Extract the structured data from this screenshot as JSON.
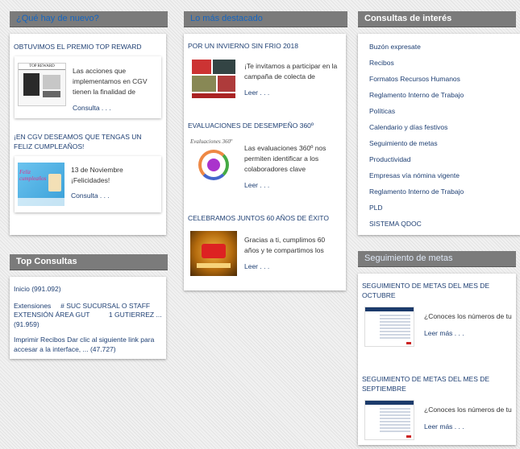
{
  "col1": {
    "header": "¿Qué hay de nuevo?",
    "articles": [
      {
        "title": "OBTUVIMOS EL PREMIO TOP REWARD",
        "text": "Las acciones que implementamos en CGV tienen la finalidad de",
        "more": "Consulta . . .",
        "thumb_text": "TOP REWARD"
      },
      {
        "title": "¡EN CGV DESEAMOS QUE TENGAS UN FELIZ CUMPLEAÑOS!",
        "text_line1": "13 de Noviembre",
        "text_line2": "¡Felicidades!",
        "more": "Consulta . . .",
        "thumb_text": "Feliz cumpleaños"
      }
    ]
  },
  "top_consultas": {
    "header": "Top Consultas",
    "items": [
      "Inicio (991.092)",
      "Extensiones     # SUC SUCURSAL O STAFF EXTENSIÓN ÁREA GUT          1 GUTIERREZ ... (91.959)",
      "Imprimir Recibos Dar clic al siguiente link para accesar a la interface, ... (47.727)"
    ]
  },
  "col2": {
    "header": "Lo más destacado",
    "articles": [
      {
        "title": "POR UN INVIERNO SIN FRIO 2018",
        "text": "¡Te invitamos a participar en la campaña de colecta de",
        "more": "Leer . . ."
      },
      {
        "title": "EVALUACIONES DE DESEMPEÑO 360º",
        "text": "Las evaluaciones 360º nos permiten identificar a los colaboradores clave",
        "more": "Leer . . .",
        "thumb_text": "Evaluaciones 360º"
      },
      {
        "title": "CELEBRAMOS JUNTOS 60 AÑOS DE ÉXITO",
        "text": "Gracias a ti, cumplimos 60 años y te compartimos los",
        "more": "Leer . . ."
      }
    ]
  },
  "col3": {
    "header": "Consultas de interés",
    "links": [
      "Buzón expresate",
      "Recibos",
      "Formatos Recursos Humanos",
      "Reglamento Interno de Trabajo",
      "Políticas",
      "Calendario y días festivos",
      "Seguimiento de metas",
      "Productividad",
      "Empresas vía nómina vigente",
      "Reglamento Interno de Trabajo",
      "PLD",
      "SISTEMA QDOC"
    ]
  },
  "metas": {
    "header": "Seguimiento de metas",
    "articles": [
      {
        "title": "SEGUIMIENTO DE METAS DEL MES DE OCTUBRE",
        "text": "¿Conoces los números de tu",
        "more": "Leer más . . ."
      },
      {
        "title": "SEGUIMIENTO DE METAS DEL MES DE SEPTIEMBRE",
        "text": "¿Conoces los números de tu",
        "more": "Leer más . . ."
      }
    ]
  },
  "colors": {
    "header_bg": "#7b7b7b",
    "header_blue_text": "#1565c0",
    "link_blue": "#1e3f73"
  }
}
